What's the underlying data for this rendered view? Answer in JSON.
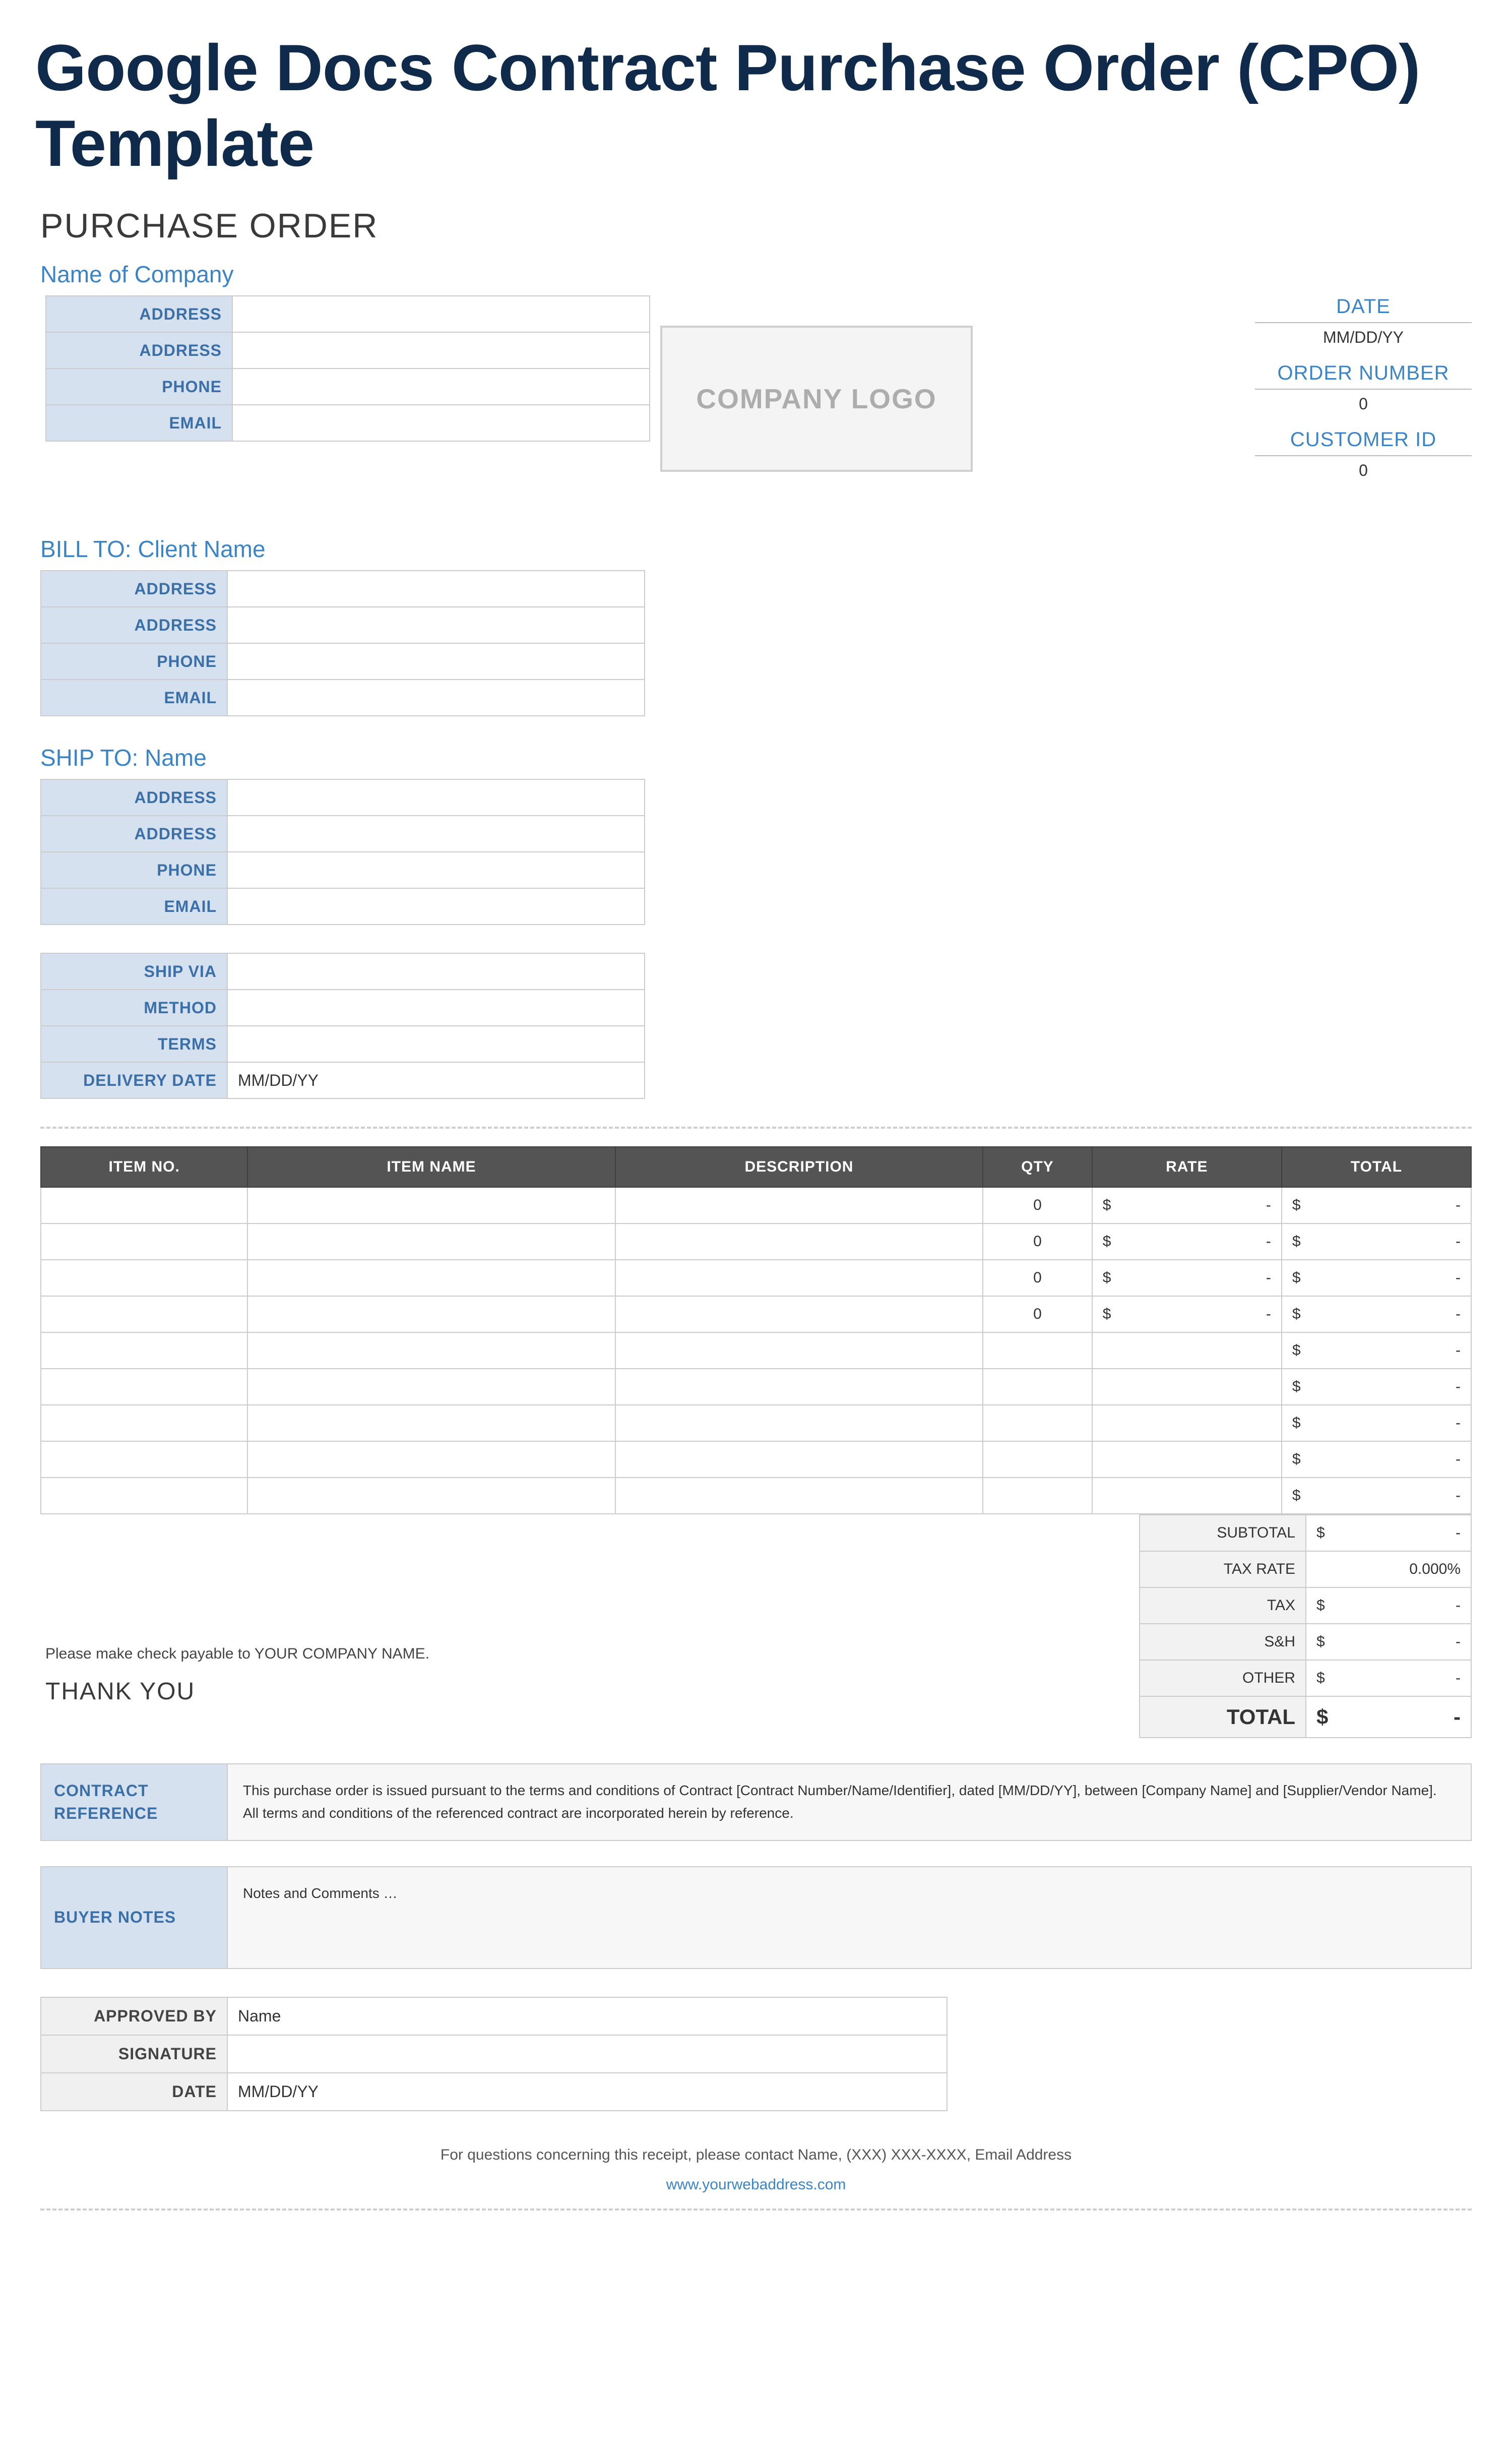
{
  "title": "Google Docs Contract Purchase Order (CPO) Template",
  "header": "PURCHASE ORDER",
  "company": {
    "title": "Name of Company",
    "rows": [
      {
        "label": "ADDRESS",
        "value": ""
      },
      {
        "label": "ADDRESS",
        "value": ""
      },
      {
        "label": "PHONE",
        "value": ""
      },
      {
        "label": "EMAIL",
        "value": ""
      }
    ]
  },
  "logo_text": "COMPANY LOGO",
  "meta": [
    {
      "label": "DATE",
      "value": "MM/DD/YY"
    },
    {
      "label": "ORDER NUMBER",
      "value": "0"
    },
    {
      "label": "CUSTOMER ID",
      "value": "0"
    }
  ],
  "bill_to": {
    "title": "BILL TO: Client Name",
    "rows": [
      {
        "label": "ADDRESS",
        "value": ""
      },
      {
        "label": "ADDRESS",
        "value": ""
      },
      {
        "label": "PHONE",
        "value": ""
      },
      {
        "label": "EMAIL",
        "value": ""
      }
    ]
  },
  "ship_to": {
    "title": "SHIP TO: Name",
    "rows": [
      {
        "label": "ADDRESS",
        "value": ""
      },
      {
        "label": "ADDRESS",
        "value": ""
      },
      {
        "label": "PHONE",
        "value": ""
      },
      {
        "label": "EMAIL",
        "value": ""
      }
    ]
  },
  "shipping": {
    "rows": [
      {
        "label": "SHIP VIA",
        "value": ""
      },
      {
        "label": "METHOD",
        "value": ""
      },
      {
        "label": "TERMS",
        "value": ""
      },
      {
        "label": "DELIVERY DATE",
        "value": "MM/DD/YY"
      }
    ]
  },
  "items": {
    "headers": [
      "ITEM NO.",
      "ITEM NAME",
      "DESCRIPTION",
      "QTY",
      "RATE",
      "TOTAL"
    ],
    "currency": "$",
    "rows": [
      {
        "no": "",
        "name": "",
        "desc": "",
        "qty": "0",
        "rate": "-",
        "total": "-"
      },
      {
        "no": "",
        "name": "",
        "desc": "",
        "qty": "0",
        "rate": "-",
        "total": "-"
      },
      {
        "no": "",
        "name": "",
        "desc": "",
        "qty": "0",
        "rate": "-",
        "total": "-"
      },
      {
        "no": "",
        "name": "",
        "desc": "",
        "qty": "0",
        "rate": "-",
        "total": "-"
      },
      {
        "no": "",
        "name": "",
        "desc": "",
        "qty": "",
        "rate": "",
        "total": "-"
      },
      {
        "no": "",
        "name": "",
        "desc": "",
        "qty": "",
        "rate": "",
        "total": "-"
      },
      {
        "no": "",
        "name": "",
        "desc": "",
        "qty": "",
        "rate": "",
        "total": "-"
      },
      {
        "no": "",
        "name": "",
        "desc": "",
        "qty": "",
        "rate": "",
        "total": "-"
      },
      {
        "no": "",
        "name": "",
        "desc": "",
        "qty": "",
        "rate": "",
        "total": "-"
      }
    ]
  },
  "summary": [
    {
      "label": "SUBTOTAL",
      "currency": "$",
      "value": "-"
    },
    {
      "label": "TAX RATE",
      "currency": "",
      "value": "0.000%"
    },
    {
      "label": "TAX",
      "currency": "$",
      "value": "-"
    },
    {
      "label": "S&H",
      "currency": "$",
      "value": "-"
    },
    {
      "label": "OTHER",
      "currency": "$",
      "value": "-"
    }
  ],
  "grand_total": {
    "label": "TOTAL",
    "currency": "$",
    "value": "-"
  },
  "check_note": "Please make check payable to YOUR COMPANY NAME.",
  "thanks": "THANK YOU",
  "contract_ref": {
    "label": "CONTRACT REFERENCE",
    "text": "This purchase order is issued pursuant to the terms and conditions of Contract [Contract Number/Name/Identifier], dated [MM/DD/YY], between [Company Name] and [Supplier/Vendor Name]. All terms and conditions of the referenced contract are incorporated herein by reference."
  },
  "buyer_notes": {
    "label": "BUYER NOTES",
    "text": "Notes and Comments …"
  },
  "approval": [
    {
      "label": "APPROVED BY",
      "value": "Name"
    },
    {
      "label": "SIGNATURE",
      "value": ""
    },
    {
      "label": "DATE",
      "value": "MM/DD/YY"
    }
  ],
  "footer": {
    "contact": "For questions concerning this receipt, please contact Name, (XXX) XXX-XXXX, Email Address",
    "web": "www.yourwebaddress.com"
  }
}
